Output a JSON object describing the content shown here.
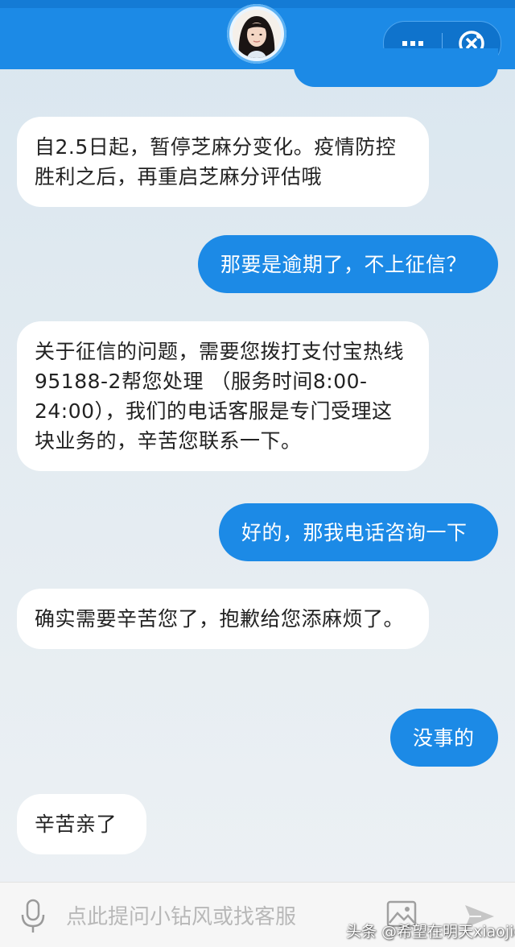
{
  "header": {
    "more_label": "···",
    "background": "#1c8ae6"
  },
  "messages": [
    {
      "from": "bot",
      "text": "自2.5日起，暂停芝麻分变化。疫情防控胜利之后，再重启芝麻分评估哦"
    },
    {
      "from": "me",
      "text": "那要是逾期了，不上征信？"
    },
    {
      "from": "bot",
      "text": "关于征信的问题，需要您拨打支付宝热线95188-2帮您处理 （服务时间8:00-24:00），我们的电话客服是专门受理这块业务的，辛苦您联系一下。"
    },
    {
      "from": "me",
      "text": "好的，那我电话咨询一下"
    },
    {
      "from": "bot",
      "text": "确实需要辛苦您了，抱歉给您添麻烦了。"
    },
    {
      "from": "me",
      "text": "没事的"
    },
    {
      "from": "bot",
      "text": "辛苦亲了"
    }
  ],
  "input": {
    "placeholder": "点此提问小钻风或找客服"
  },
  "watermark": "头条 @希望在明天xiaojie",
  "icons": [
    "avatar",
    "more-icon",
    "close-icon",
    "mic-icon",
    "image-icon",
    "send-icon"
  ],
  "colors": {
    "accent": "#1c8ae6",
    "bot_bubble": "#ffffff",
    "user_text": "#ffffff"
  }
}
